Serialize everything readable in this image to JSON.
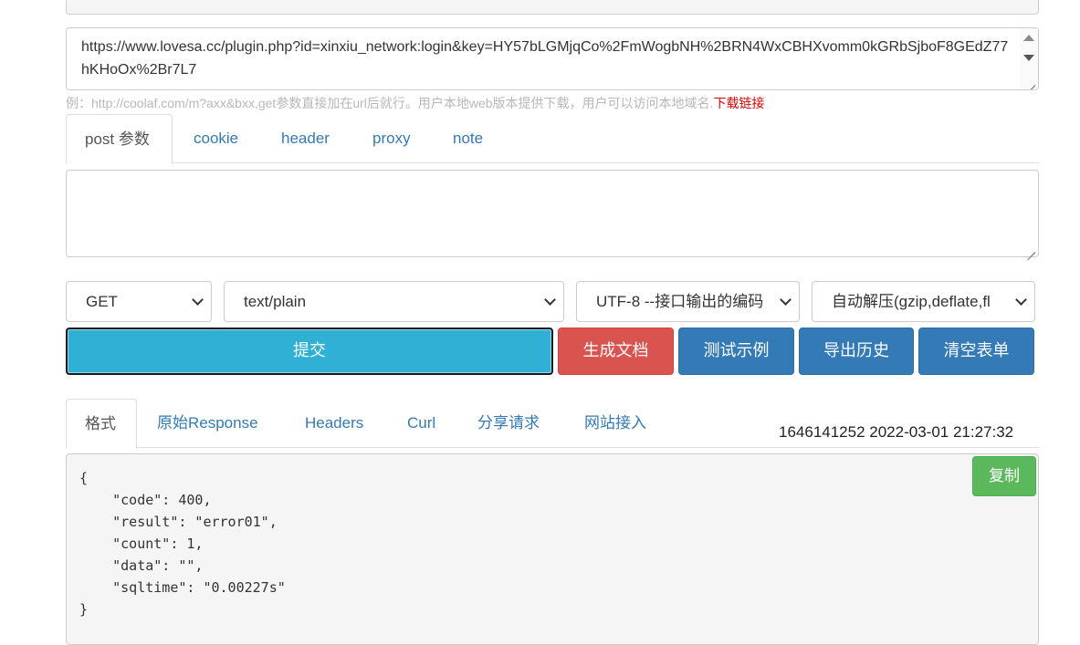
{
  "request": {
    "url_value": "https://www.lovesa.cc/plugin.php?id=xinxiu_network:login&key=HY57bLGMjqCo%2FmWogbNH%2BRN4WxCBHXvomm0kGRbSjboF8GEdZ77hKHoOx%2Br7L7",
    "hint_text": "例：http://coolaf.com/m?axx&bxx,get参数直接加在url后就行。用户本地web版本提供下载，用户可以访问本地域名.",
    "hint_link": "下载链接"
  },
  "param_tabs": [
    {
      "label": "post 参数"
    },
    {
      "label": "cookie"
    },
    {
      "label": "header"
    },
    {
      "label": "proxy"
    },
    {
      "label": "note"
    }
  ],
  "post_body": "",
  "selects": {
    "method": "GET",
    "content_type": "text/plain",
    "encoding": "UTF-8 --接口输出的编码",
    "decompress": "自动解压(gzip,deflate,fl"
  },
  "buttons": {
    "submit": "提交",
    "generate_doc": "生成文档",
    "test_example": "测试示例",
    "export_history": "导出历史",
    "clear_form": "清空表单",
    "copy": "复制"
  },
  "result_tabs": [
    {
      "label": "格式"
    },
    {
      "label": "原始Response"
    },
    {
      "label": "Headers"
    },
    {
      "label": "Curl"
    },
    {
      "label": "分享请求"
    },
    {
      "label": "网站接入"
    }
  ],
  "timestamp": "1646141252 2022-03-01 21:27:32",
  "response_json": "{\n    \"code\": 400,\n    \"result\": \"error01\",\n    \"count\": 1,\n    \"data\": \"\",\n    \"sqltime\": \"0.00227s\"\n}",
  "colors": {
    "primary": "#337ab7",
    "info": "#31b0d5",
    "danger": "#d9534f",
    "success": "#5cb85c"
  }
}
